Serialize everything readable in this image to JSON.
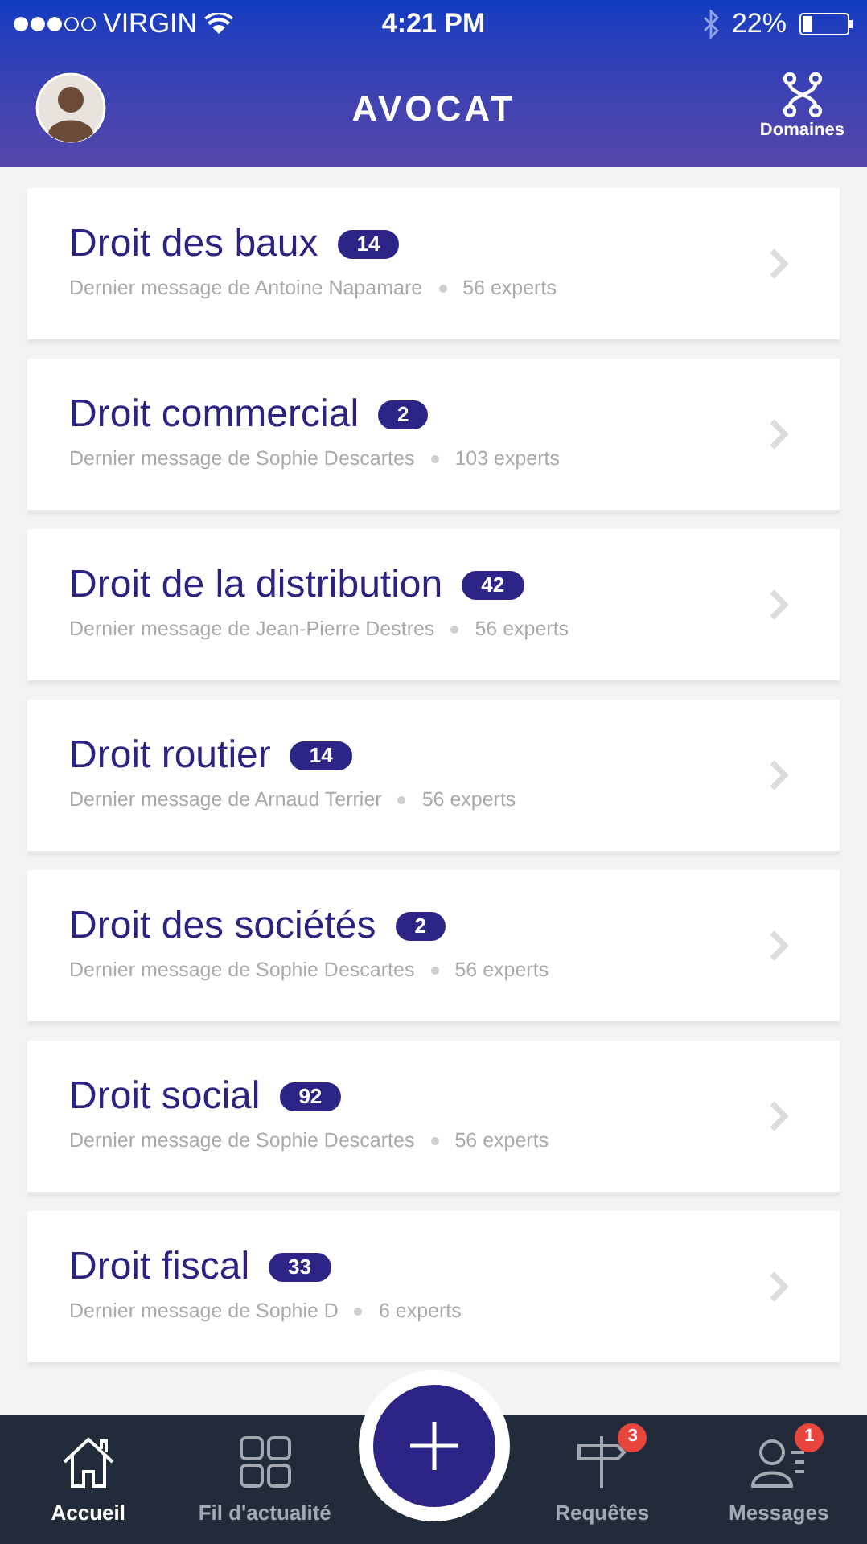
{
  "status_bar": {
    "carrier": "VIRGIN",
    "time": "4:21 PM",
    "battery": "22%"
  },
  "header": {
    "title": "AVOCAT",
    "action": "Domaines"
  },
  "domains": [
    {
      "title": "Droit des baux",
      "count": "14",
      "author": "Dernier message de Antoine Napamare",
      "experts": "56 experts"
    },
    {
      "title": "Droit commercial",
      "count": "2",
      "author": "Dernier message de Sophie Descartes",
      "experts": "103 experts"
    },
    {
      "title": "Droit de la distribution",
      "count": "42",
      "author": "Dernier message de Jean-Pierre Destres",
      "experts": "56 experts"
    },
    {
      "title": "Droit routier",
      "count": "14",
      "author": "Dernier message de Arnaud Terrier",
      "experts": "56 experts"
    },
    {
      "title": "Droit des sociétés",
      "count": "2",
      "author": "Dernier message de Sophie Descartes",
      "experts": "56 experts"
    },
    {
      "title": "Droit social",
      "count": "92",
      "author": "Dernier message de Sophie Descartes",
      "experts": "56 experts"
    },
    {
      "title": "Droit fiscal",
      "count": "33",
      "author": "Dernier message de Sophie D",
      "experts": "6 experts"
    }
  ],
  "tab_bar": [
    {
      "kind": "home",
      "label": "Accueil",
      "selected": true
    },
    {
      "kind": "grid",
      "label": "Fil d'actualité",
      "selected": false
    },
    {
      "kind": "add"
    },
    {
      "kind": "signpost",
      "label": "Requêtes",
      "selected": false,
      "badge": "3"
    },
    {
      "kind": "messages",
      "label": "Messages",
      "selected": false,
      "badge": "1"
    }
  ]
}
